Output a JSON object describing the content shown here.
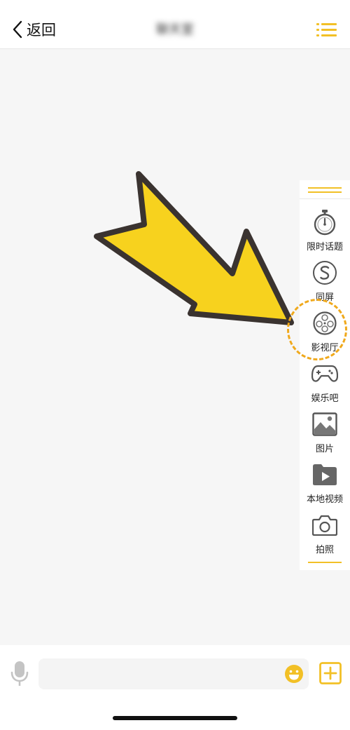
{
  "header": {
    "back_label": "返回",
    "title": "聊天室"
  },
  "side_panel": {
    "items": [
      {
        "label": "限时话题",
        "icon": "stopwatch-icon"
      },
      {
        "label": "同屏",
        "icon": "sync-screen-icon"
      },
      {
        "label": "影视厅",
        "icon": "film-reel-icon",
        "highlighted": true
      },
      {
        "label": "娱乐吧",
        "icon": "gamepad-icon"
      },
      {
        "label": "图片",
        "icon": "image-icon"
      },
      {
        "label": "本地视频",
        "icon": "video-folder-icon"
      },
      {
        "label": "拍照",
        "icon": "camera-icon"
      }
    ]
  },
  "input_bar": {
    "message_value": "",
    "message_placeholder": ""
  },
  "colors": {
    "accent": "#f2c026",
    "highlight_ring": "#f0a91c",
    "arrow_fill": "#f7d21e",
    "arrow_stroke": "#3a3330",
    "background": "#f6f6f6"
  }
}
